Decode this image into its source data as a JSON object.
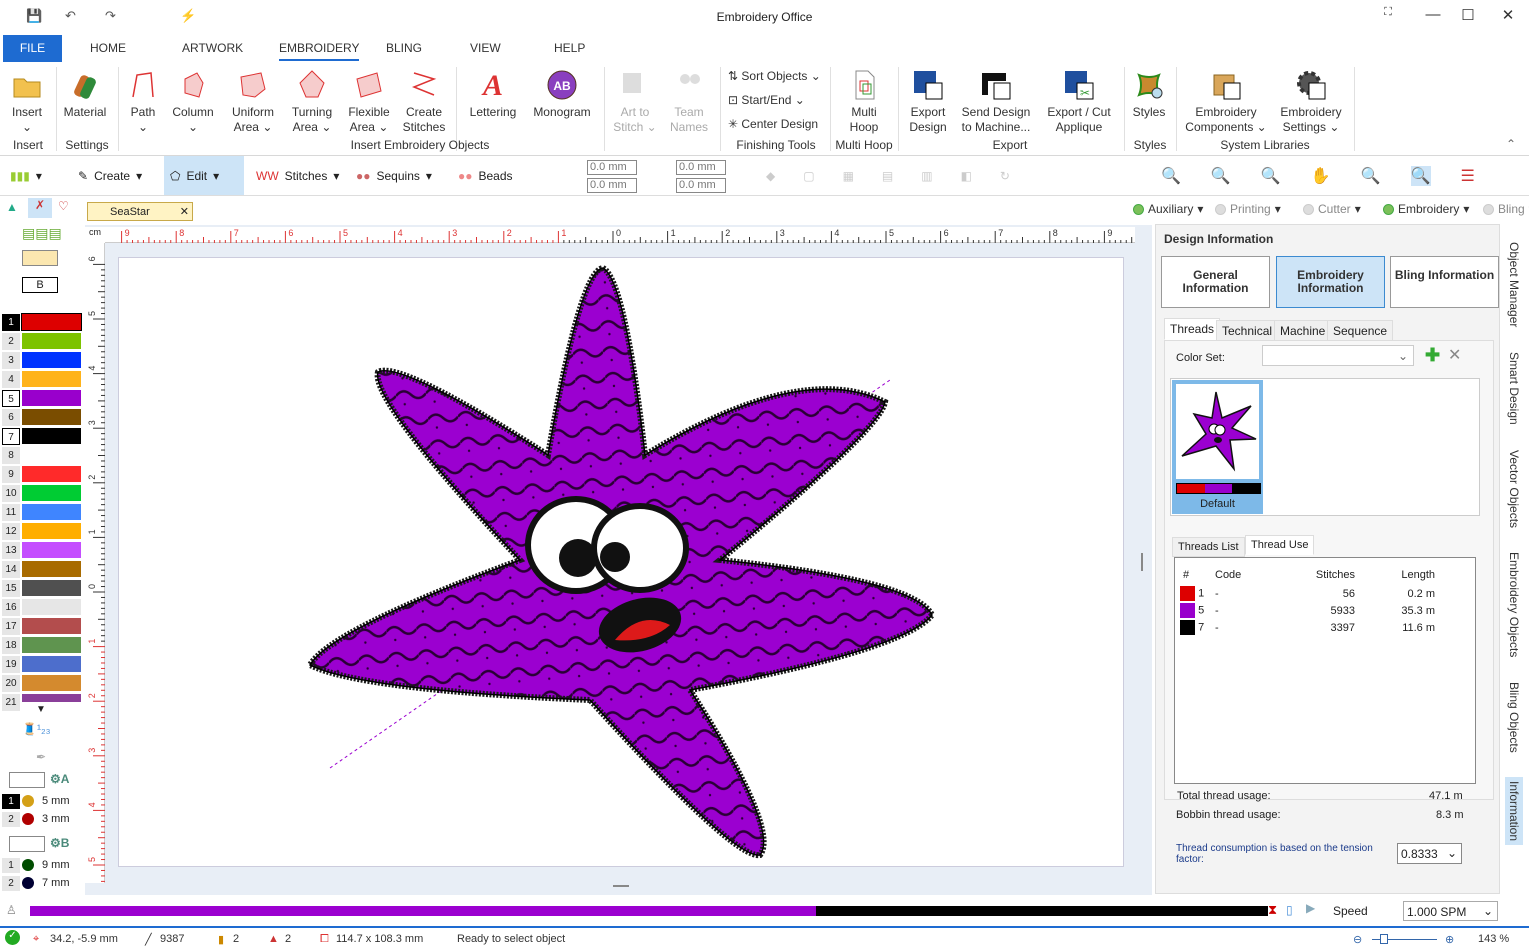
{
  "window": {
    "title": "Embroidery Office"
  },
  "menu": {
    "tabs": [
      "FILE",
      "HOME",
      "ARTWORK",
      "EMBROIDERY",
      "BLING",
      "VIEW",
      "HELP"
    ],
    "active": "EMBROIDERY"
  },
  "ribbon": {
    "buttons": {
      "insert": "Insert",
      "material": "Material",
      "path": "Path",
      "column": "Column",
      "uniform": "Uniform Area",
      "turning": "Turning Area",
      "flexible": "Flexible Area",
      "create_stitches": "Create Stitches",
      "lettering": "Lettering",
      "monogram": "Monogram",
      "art_to_stitch": "Art to Stitch",
      "team_names": "Team Names",
      "sort_objects": "Sort Objects",
      "start_end": "Start/End",
      "center_design": "Center Design",
      "multi_hoop": "Multi Hoop",
      "export_design": "Export Design",
      "send_design": "Send Design to Machine...",
      "export_cut": "Export / Cut Applique",
      "styles": "Styles",
      "emb_components": "Embroidery Components",
      "emb_settings": "Embroidery Settings"
    },
    "groups": {
      "insert": "Insert",
      "settings": "Settings",
      "insert_objects": "Insert Embroidery Objects",
      "finishing": "Finishing Tools",
      "multi_hoop": "Multi Hoop",
      "export": "Export",
      "styles": "Styles",
      "system": "System Libraries"
    }
  },
  "toolbar": {
    "create": "Create",
    "edit": "Edit",
    "stitches": "Stitches",
    "sequins": "Sequins",
    "beads": "Beads",
    "x": "0.0 mm",
    "y": "0.0 mm",
    "w": "0.0 mm",
    "h": "0.0 mm"
  },
  "document": {
    "tab": "SeaStar"
  },
  "layers": [
    {
      "label": "Auxiliary",
      "on": true
    },
    {
      "label": "Printing",
      "on": false
    },
    {
      "label": "Cutter",
      "on": false
    },
    {
      "label": "Embroidery",
      "on": true
    },
    {
      "label": "Bling",
      "on": false
    }
  ],
  "palette": {
    "letter": "B",
    "colors": [
      {
        "n": "1",
        "c": "#dd0000",
        "state": "sel"
      },
      {
        "n": "2",
        "c": "#7dc300"
      },
      {
        "n": "3",
        "c": "#0033ff"
      },
      {
        "n": "4",
        "c": "#ffb31a"
      },
      {
        "n": "5",
        "c": "#9900cc",
        "state": "box"
      },
      {
        "n": "6",
        "c": "#7a4d00"
      },
      {
        "n": "7",
        "c": "#000000",
        "state": "box"
      },
      {
        "n": "8",
        "c": "#ffffff"
      },
      {
        "n": "9",
        "c": "#ff2a2a"
      },
      {
        "n": "10",
        "c": "#00cc33"
      },
      {
        "n": "11",
        "c": "#3f85ff"
      },
      {
        "n": "12",
        "c": "#ffae00"
      },
      {
        "n": "13",
        "c": "#c44dff"
      },
      {
        "n": "14",
        "c": "#a86b00"
      },
      {
        "n": "15",
        "c": "#505050"
      },
      {
        "n": "16",
        "c": "#e6e6e6"
      },
      {
        "n": "17",
        "c": "#b34d4d"
      },
      {
        "n": "18",
        "c": "#5f944f"
      },
      {
        "n": "19",
        "c": "#4d6ecc"
      },
      {
        "n": "20",
        "c": "#d48a2e"
      },
      {
        "n": "21",
        "c": "#8a3f99"
      }
    ],
    "sequins_a": {
      "label": "A",
      "items": [
        {
          "n": "1",
          "size": "5 mm",
          "c": "#d4a017"
        },
        {
          "n": "2",
          "size": "3 mm",
          "c": "#b00000"
        }
      ]
    },
    "sequins_b": {
      "label": "B",
      "items": [
        {
          "n": "1",
          "size": "9 mm",
          "c": "#004d00"
        },
        {
          "n": "2",
          "size": "7 mm",
          "c": "#000033"
        }
      ]
    }
  },
  "ruler": {
    "unit": "cm",
    "h_labels": [
      "9",
      "8",
      "7",
      "6",
      "5",
      "4",
      "3",
      "2",
      "1",
      "0",
      "1",
      "2",
      "3",
      "4",
      "5",
      "6",
      "7",
      "8",
      "9"
    ],
    "v_labels": [
      "6",
      "5",
      "4",
      "3",
      "2",
      "1",
      "0",
      "1",
      "2",
      "3",
      "4",
      "5"
    ]
  },
  "design_info": {
    "title": "Design Information",
    "buttons": [
      "General Information",
      "Embroidery Information",
      "Bling Information"
    ],
    "active_button": "Embroidery Information",
    "tabs": [
      "Threads",
      "Technical",
      "Machine",
      "Sequence"
    ],
    "color_set_label": "Color Set:",
    "color_set_value": "",
    "thumb_label": "Default",
    "thumb_colors": [
      "#dd0000",
      "#9900cc",
      "#000000"
    ],
    "list_tabs": [
      "Threads List",
      "Thread Use"
    ],
    "columns": [
      "#",
      "Code",
      "Stitches",
      "Length"
    ],
    "rows": [
      {
        "color": "#dd0000",
        "n": "1",
        "code": "-",
        "stitches": "56",
        "length": "0.2 m"
      },
      {
        "color": "#9900cc",
        "n": "5",
        "code": "-",
        "stitches": "5933",
        "length": "35.3 m"
      },
      {
        "color": "#000000",
        "n": "7",
        "code": "-",
        "stitches": "3397",
        "length": "11.6 m"
      }
    ],
    "total_label": "Total thread usage:",
    "total": "47.1 m",
    "bobbin_label": "Bobbin thread usage:",
    "bobbin": "8.3 m",
    "tension_label": "Thread consumption is based on the tension factor:",
    "tension": "0.8333"
  },
  "side_tabs": [
    "Object Manager",
    "Smart Design",
    "Vector Objects",
    "Embroidery Objects",
    "Bling Objects",
    "Information"
  ],
  "player": {
    "speed_label": "Speed",
    "speed": "1.000 SPM",
    "progress": 1.0
  },
  "status": {
    "coords": "34.2, -5.9 mm",
    "stitches": "9387",
    "colors": "2",
    "sequins": "2",
    "size": "114.7 x 108.3 mm",
    "message": "Ready to select object",
    "zoom": "143 %"
  }
}
